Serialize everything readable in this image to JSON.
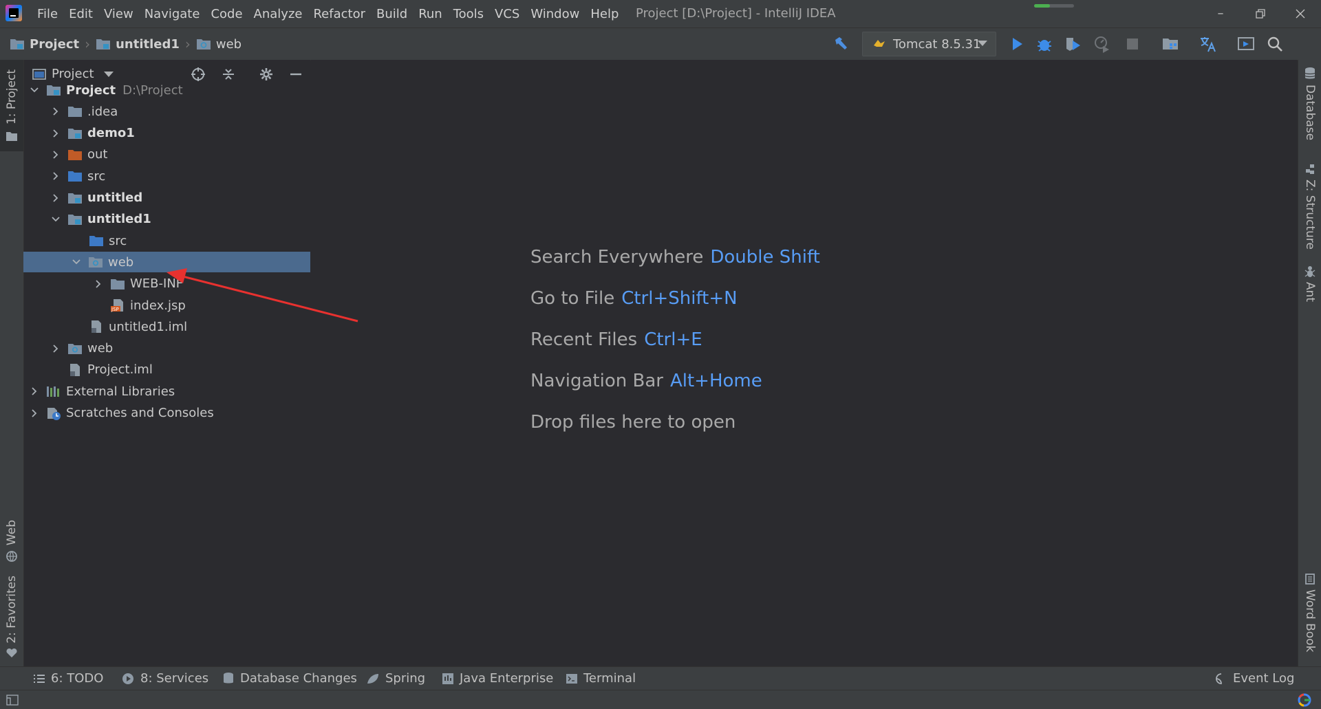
{
  "window": {
    "title": "Project [D:\\Project] - IntelliJ IDEA",
    "minimize_icon": "minimize-icon",
    "restore_icon": "restore-icon",
    "close_icon": "close-icon"
  },
  "menu": [
    "File",
    "Edit",
    "View",
    "Navigate",
    "Code",
    "Analyze",
    "Refactor",
    "Build",
    "Run",
    "Tools",
    "VCS",
    "Window",
    "Help"
  ],
  "breadcrumb": [
    "Project",
    "untitled1",
    "web"
  ],
  "run_config": {
    "label": "Tomcat 8.5.31"
  },
  "side_tabs": {
    "left_top": "1: Project",
    "left_web": "Web",
    "left_favorites": "2: Favorites",
    "right_database": "Database",
    "right_structure": "Z: Structure",
    "right_ant": "Ant",
    "right_wordbook": "Word Book"
  },
  "project_panel": {
    "title": "Project",
    "tree": [
      {
        "label": "Project",
        "path": "D:\\Project",
        "bold": true,
        "expanded": true,
        "icon": "module-folder-icon"
      },
      {
        "label": ".idea",
        "bold": false,
        "expanded": false,
        "icon": "folder-icon"
      },
      {
        "label": "demo1",
        "bold": true,
        "expanded": false,
        "icon": "module-folder-icon"
      },
      {
        "label": "out",
        "bold": false,
        "expanded": false,
        "icon": "excluded-folder-icon"
      },
      {
        "label": "src",
        "bold": false,
        "expanded": false,
        "icon": "source-folder-icon"
      },
      {
        "label": "untitled",
        "bold": true,
        "expanded": false,
        "icon": "module-folder-icon"
      },
      {
        "label": "untitled1",
        "bold": true,
        "expanded": true,
        "icon": "module-folder-icon"
      },
      {
        "label": "src",
        "bold": false,
        "icon": "source-folder-icon"
      },
      {
        "label": "web",
        "bold": false,
        "expanded": true,
        "selected": true,
        "icon": "web-folder-icon"
      },
      {
        "label": "WEB-INF",
        "bold": false,
        "expanded": false,
        "icon": "folder-icon"
      },
      {
        "label": "index.jsp",
        "bold": false,
        "icon": "jsp-file-icon"
      },
      {
        "label": "untitled1.iml",
        "bold": false,
        "icon": "iml-file-icon"
      },
      {
        "label": "web",
        "bold": false,
        "expanded": false,
        "icon": "web-folder-icon"
      },
      {
        "label": "Project.iml",
        "bold": false,
        "icon": "iml-file-icon"
      },
      {
        "label": "External Libraries",
        "bold": false,
        "expanded": false,
        "icon": "libraries-icon"
      },
      {
        "label": "Scratches and Consoles",
        "bold": false,
        "expanded": false,
        "icon": "scratches-icon"
      }
    ]
  },
  "editor_hints": [
    {
      "text": "Search Everywhere",
      "key": "Double Shift"
    },
    {
      "text": "Go to File",
      "key": "Ctrl+Shift+N"
    },
    {
      "text": "Recent Files",
      "key": "Ctrl+E"
    },
    {
      "text": "Navigation Bar",
      "key": "Alt+Home"
    },
    {
      "text": "Drop files here to open",
      "key": ""
    }
  ],
  "bottom_tabs": [
    "6: TODO",
    "8: Services",
    "Database Changes",
    "Spring",
    "Java Enterprise",
    "Terminal"
  ],
  "event_log": "Event Log",
  "colors": {
    "accent": "#589df6",
    "selection": "#4b6a8e",
    "annotation_arrow": "#e8312f"
  }
}
